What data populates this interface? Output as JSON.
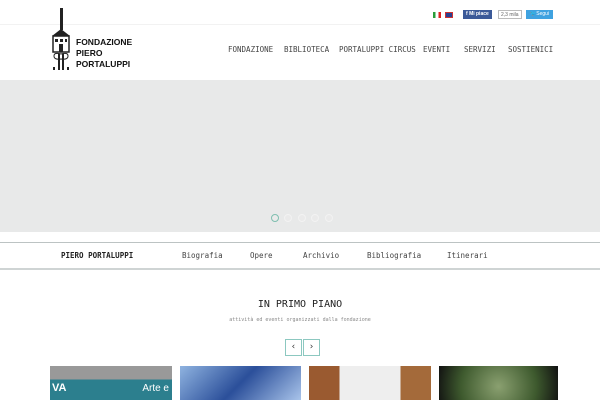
{
  "header": {
    "logo_lines": [
      "FONDAZIONE",
      "PIERO",
      "PORTALUPPI"
    ],
    "languages": [
      "it",
      "en"
    ],
    "facebook": {
      "label": "Mi piace",
      "count": "2,3 mila"
    },
    "twitter": {
      "label": "Segui"
    },
    "nav": [
      "FONDAZIONE",
      "BIBLIOTECA",
      "PORTALUPPI CIRCUS",
      "EVENTI",
      "SERVIZI",
      "SOSTIENICI"
    ]
  },
  "slider": {
    "slides": 5,
    "active": 0
  },
  "subnav": {
    "title": "PIERO PORTALUPPI",
    "items": [
      "Biografia",
      "Opere",
      "Archivio",
      "Bibliografia",
      "Itinerari"
    ]
  },
  "featured": {
    "title": "IN PRIMO PIANO",
    "subtitle": "attività ed eventi organizzati dalla fondazione",
    "prev": "‹",
    "next": "›",
    "card1_text": "Arte e"
  },
  "colors": {
    "accent": "#7fbfb0",
    "slider_bg": "#e8e9e9"
  }
}
